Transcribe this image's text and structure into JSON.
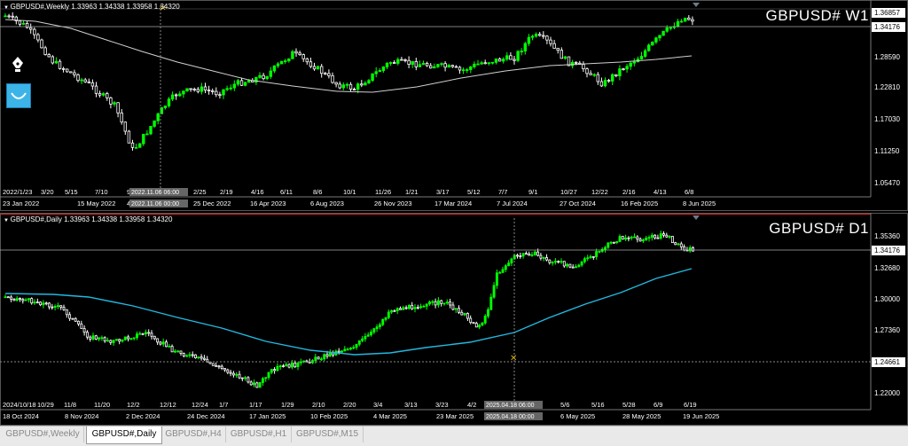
{
  "weekly": {
    "header": "GBPUSD#,Weekly 1.33963 1.34338 1.33958 1.34320",
    "symbol_label": "GBPUSD# W1",
    "prices": [
      "1.36857",
      "1.34176",
      "1.28590",
      "1.22810",
      "1.17030",
      "1.11250",
      "1.05470"
    ],
    "highlight_price": "1.36857",
    "current_price": "1.34176",
    "date_labels": [
      "23 Jan 2022",
      "15 May 2022",
      "4",
      "2022.11.06 00:00",
      "25 Dec 2022",
      "16 Apr 2023",
      "6 Aug 2023",
      "26 Nov 2023",
      "17 Mar 2024",
      "7 Jul 2024",
      "27 Oct 2024",
      "16 Feb 2025",
      "8 Jun 2025"
    ],
    "grid_labels": [
      "2022/1/23",
      "3/20",
      "5/15",
      "7/10",
      "9/",
      "2022.11.06 06:00",
      "2/25",
      "2/19",
      "4/16",
      "6/11",
      "8/6",
      "10/1",
      "11/26",
      "1/21",
      "3/17",
      "5/12",
      "7/7",
      "9/1",
      "10/27",
      "12/22",
      "2/16",
      "4/13",
      "6/8"
    ]
  },
  "daily": {
    "header": "GBPUSD#,Daily 1.33963 1.34338 1.33958 1.34320",
    "symbol_label": "GBPUSD# D1",
    "prices": [
      "1.35360",
      "1.34176",
      "1.32680",
      "1.30000",
      "1.27360",
      "1.24661",
      "1.22000"
    ],
    "current_price": "1.34176",
    "highlight_price": "1.24661",
    "date_labels": [
      "18 Oct 2024",
      "8 Nov 2024",
      "2 Dec 2024",
      "24 Dec 2024",
      "17 Jan 2025",
      "10 Feb 2025",
      "4 Mar 2025",
      "23 Mar 2025",
      "2025.04.18 00:00",
      "6 May 2025",
      "28 May 2025",
      "19 Jun 2025"
    ],
    "grid_labels": [
      "2024/10/18",
      "10/29",
      "11/8",
      "11/20",
      "12/2",
      "12/12",
      "12/24",
      "1/7",
      "1/17",
      "1/29",
      "2/10",
      "2/20",
      "3/4",
      "3/13",
      "3/23",
      "4/2",
      "2025.04.18 06:00",
      "5/6",
      "5/16",
      "5/28",
      "6/9",
      "6/19"
    ]
  },
  "tabs": [
    {
      "label": "GBPUSD#,Weekly",
      "active": false
    },
    {
      "label": "GBPUSD#,Daily",
      "active": true
    },
    {
      "label": "GBPUSD#,H4",
      "active": false
    },
    {
      "label": "GBPUSD#,H1",
      "active": false
    },
    {
      "label": "GBPUSD#,M15",
      "active": false
    }
  ],
  "colors": {
    "bull": "#00ff00",
    "bear": "#ffffff",
    "ma_weekly": "#d0d0d0",
    "ma_daily": "#22b8e0",
    "accent_red": "#e02020"
  },
  "icons": [
    "pen-tool-icon",
    "smile-curve-icon",
    "crosshair-icon"
  ]
}
